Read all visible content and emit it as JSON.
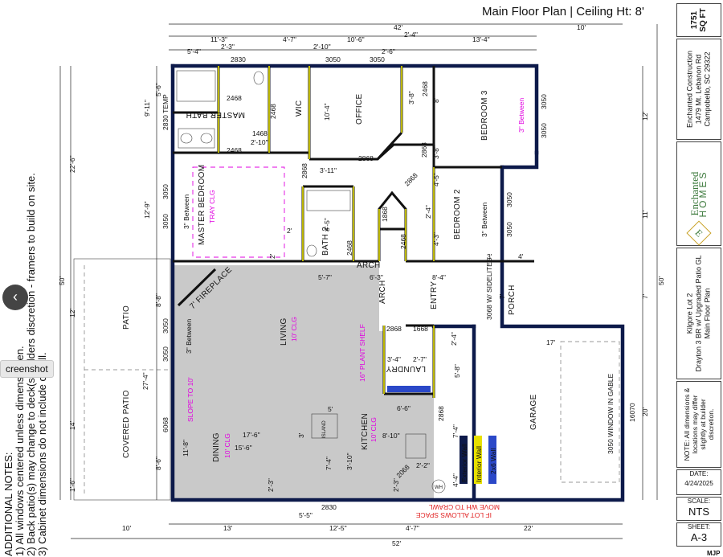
{
  "title": "Main Floor Plan | Ceiling Ht: 8'",
  "sqft": {
    "value": "1751",
    "unit": "SQ FT"
  },
  "builder": {
    "company": "Enchanted Construction",
    "street": "1479 Mt. Lebanon Rd",
    "city": "Campobello, SC 29322",
    "logo_top": "Enchanted",
    "logo_bottom": "HOMES",
    "logo_mark": "E"
  },
  "project": {
    "lot": "Kilgore Lot 2",
    "plan": "Drayton 3 BR w/ Upgraded Patio GL",
    "sheet_desc": "Main Floor Plan"
  },
  "disclaimer": {
    "l1": "NOTE: All dimensions &",
    "l2": "locations may differ",
    "l3": "slightly at builder",
    "l4": "discretion."
  },
  "date": {
    "label": "DATE:",
    "value": "4/24/2025"
  },
  "scale": {
    "label": "SCALE:",
    "value": "NTS"
  },
  "sheet": {
    "label": "SHEET:",
    "value": "A-3"
  },
  "notes": {
    "heading": "ADDITIONAL NOTES:",
    "n1": "1) All windows centered unless dimens   given.",
    "n2": "2) Back patio(s) may change to deck(s   builders discretion - framers to build on site.",
    "n3": "3) Cabinet dimensions do not include c   wall."
  },
  "overlay": {
    "screenshot_tip": "creenshot",
    "nav_arrow": "‹",
    "corner_mark": "MJP"
  },
  "rooms": {
    "master_bath": "MASTER BATH",
    "wic": "WIC",
    "office": "OFFICE",
    "bedroom3": "BEDROOM 3",
    "master_bedroom": "MASTER BEDROOM",
    "tray": "TRAY CLG",
    "bath2": "BATH 2",
    "bedroom2": "BEDROOM 2",
    "living": "LIVING",
    "living_clg": "10' CLG",
    "entry": "ENTRY",
    "porch": "PORCH",
    "laundry": "LAUNDRY",
    "garage": "GARAGE",
    "patio": "PATIO",
    "covered_patio": "COVERED PATIO",
    "dining": "DINING",
    "dining_clg": "10' CLG",
    "kitchen": "KITCHEN",
    "kitchen_clg": "10' CLG",
    "fireplace": "7' FIREPLACE",
    "plant_shelf": "16\" PLANT SHELF",
    "slope": "SLOPE TO 10'",
    "arch1": "ARCH",
    "arch2": "ARCH",
    "sidelites": "3068 W/ SIDELITES",
    "garage_window": "3050 WINDOW IN GABLE",
    "crawl_note1": "MOVE WH TO CRAWL",
    "crawl_note2": "IF LOT ALLOWS SPACE",
    "between1": "3\" Between",
    "between2": "3\" Between",
    "between3": "3\" Between",
    "between4": "3\" Between",
    "temp": "2830 TEMP",
    "wh": "WH",
    "island": "ISLAND"
  },
  "legend": {
    "exterior": "Exterior Wall",
    "interior": "Interior Wall",
    "two_by_six": "2x6 Wall"
  },
  "dims": {
    "top_42": "42'",
    "top_10": "10'",
    "top_11_3": "11'-3\"",
    "top_4_7": "4'-7\"",
    "top_10_6": "10'-6\"",
    "top_2_4": "2'-4\"",
    "top_13_4": "13'-4\"",
    "top_2_3": "2'-3\"",
    "top_2_10": "2'-10\"",
    "top_5_4": "5'-4\"",
    "top_2_6": "2'-6\"",
    "top_2830": "2830",
    "top_3050a": "3050",
    "top_3050b": "3050",
    "bot_52": "52'",
    "bot_10": "10'",
    "bot_13": "13'",
    "bot_12_5": "12'-5\"",
    "bot_4_7": "4'-7\"",
    "bot_22": "22'",
    "bot_5_5": "5'-5\"",
    "bot_2830": "2830",
    "left_50": "50'",
    "left_22_6": "22'-6\"",
    "left_12": "12'",
    "left_14": "14'",
    "left_27_4": "27'-4\"",
    "left_9_11": "9'-11\"",
    "left_5_6": "5'-6\"",
    "left_12_9": "12'-9\"",
    "left_8_8": "8'-8\"",
    "left_8_6": "8'-6\"",
    "left_3050a": "3050",
    "left_3050b": "3050",
    "left_3050c": "3050",
    "left_3050d": "3050",
    "left_6068": "6068",
    "left_11_8": "11'-8\"",
    "left_1_6": "1'-6\"",
    "right_50": "50'",
    "right_12": "12'",
    "right_11": "11'",
    "right_7": "7'",
    "right_20": "20'",
    "right_3050a": "3050",
    "right_3050b": "3050",
    "right_3050c": "3050",
    "right_3050d": "3050",
    "right_16070": "16070",
    "right_17": "17'",
    "d2468a": "2468",
    "d2468b": "2468",
    "d2468c": "2468",
    "d2468d": "2468",
    "d2468e": "2468",
    "d2468f": "2468",
    "d2468g": "2468",
    "d2468h": "2468",
    "d1468": "1468",
    "d2868a": "2868",
    "d2868b": "2868",
    "d2868c": "2868",
    "d2868d": "2868",
    "d2868e": "2868",
    "d2868f": "2868",
    "d1868": "1868",
    "d1668": "1668",
    "d2068": "2068",
    "d10_4": "10'-4\"",
    "d3_11": "3'-11\"",
    "d3_8a": "3'-8\"",
    "d3_8b": "3'-8\"",
    "d2_a": "2'",
    "d2_b": "2'",
    "d8": "8'",
    "d8_5": "8'-5\"",
    "d2_4": "2'-4\"",
    "d4_3": "4'-3\"",
    "d4_5": "4'-5\"",
    "d3": "3'",
    "d4": "4'",
    "d5_7": "5'-7\"",
    "d6_3": "6'-3\"",
    "d8_4": "8'-4\"",
    "d7": "7'",
    "d2_4b": "2'-4\"",
    "d5_8": "5'-8\"",
    "d3_4": "3'-4\"",
    "d2_7": "2'-7\"",
    "d6_6": "6'-6\"",
    "d17_6": "17'-6\"",
    "d15_6": "15'-6\"",
    "d5": "5'",
    "d3_10": "3'-10\"",
    "d7_4": "7'-4\"",
    "d8_10": "8'-10\"",
    "d7_4b": "7'-4\"",
    "d4_4": "4'-4\"",
    "d2_3": "2'-3\"",
    "d2_3b": "2'-3\"",
    "d2_10": "2'-10\"",
    "d2_2": "2'-2\"",
    "d1_6": "1'-6\"",
    "d3b": "3'",
    "d2c": "2'",
    "d2d": "2'"
  }
}
